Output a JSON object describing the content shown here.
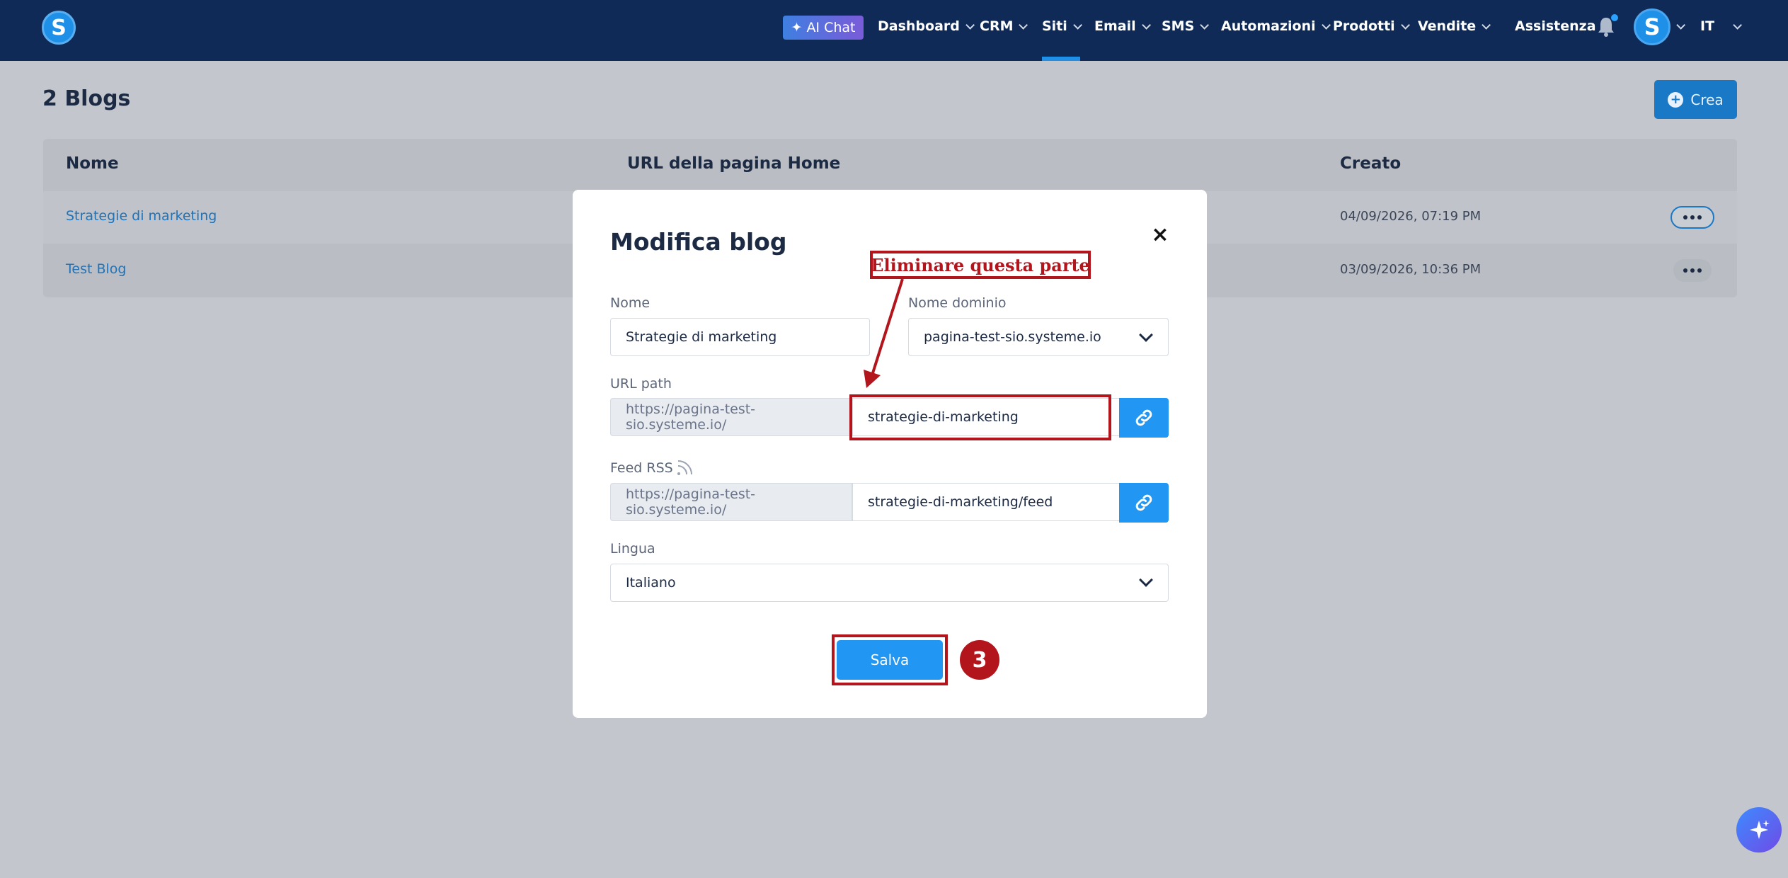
{
  "nav": {
    "logo_letter": "S",
    "ai_chat": "AI Chat",
    "items": [
      "Dashboard",
      "CRM",
      "Siti",
      "Email",
      "SMS",
      "Automazioni",
      "Prodotti",
      "Vendite"
    ],
    "assistenza": "Assistenza",
    "avatar_letter": "S",
    "language": "IT",
    "active_item": "Siti"
  },
  "page": {
    "title": "2 Blogs",
    "create_button": "Crea"
  },
  "table": {
    "headers": [
      "Nome",
      "URL della pagina Home",
      "Creato"
    ],
    "rows": [
      {
        "name": "Strategie di marketing",
        "created": "04/09/2026, 07:19 PM"
      },
      {
        "name": "Test Blog",
        "created": "03/09/2026, 10:36 PM"
      }
    ]
  },
  "modal": {
    "title": "Modifica blog",
    "name_label": "Nome",
    "name_value": "Strategie di marketing",
    "domain_label": "Nome dominio",
    "domain_value": "pagina-test-sio.systeme.io",
    "url_path_label": "URL path",
    "url_prefix": "https://pagina-test-sio.systeme.io/",
    "url_path_value": "strategie-di-marketing",
    "feed_label": "Feed RSS",
    "feed_prefix": "https://pagina-test-sio.systeme.io/",
    "feed_value": "strategie-di-marketing/feed",
    "language_label": "Lingua",
    "language_value": "Italiano",
    "save_button": "Salva"
  },
  "annotation": {
    "callout": "Eliminare questa parte",
    "step_number": "3",
    "color": "#b3151c"
  },
  "colors": {
    "nav_bg": "#0f2a56",
    "primary": "#2196f3",
    "link": "#2173b8"
  },
  "icons": [
    "sparkle-icon",
    "chevron-down-icon",
    "bell-icon",
    "plus-circle-icon",
    "more-dots-icon",
    "close-icon",
    "link-icon",
    "rss-icon",
    "magic-sparkle-icon"
  ]
}
